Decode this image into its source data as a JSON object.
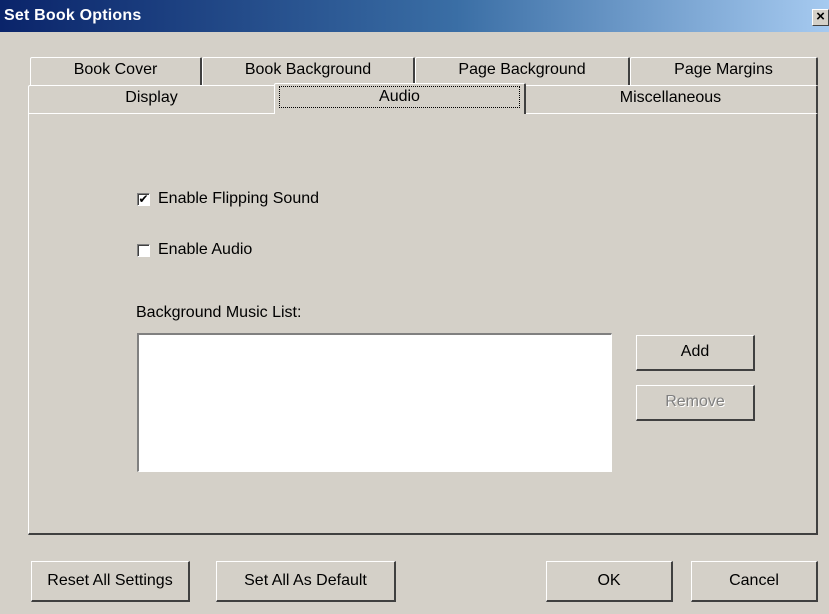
{
  "window": {
    "title": "Set Book Options",
    "close_glyph": "×"
  },
  "tabs_top": [
    {
      "label": "Book Cover"
    },
    {
      "label": "Book Background"
    },
    {
      "label": "Page Background"
    },
    {
      "label": "Page Margins"
    }
  ],
  "tabs_bottom": [
    {
      "label": "Display"
    },
    {
      "label": "Audio",
      "active": true
    },
    {
      "label": "Miscellaneous"
    }
  ],
  "audio": {
    "flipping_sound": {
      "label": "Enable Flipping Sound",
      "checked": true,
      "mark": "✔"
    },
    "enable_audio": {
      "label": "Enable Audio",
      "checked": false
    },
    "music_list_label": "Background Music List:",
    "music_list": [],
    "add_label": "Add",
    "remove_label": "Remove"
  },
  "footer": {
    "reset_label": "Reset All Settings",
    "default_label": "Set All As Default",
    "ok_label": "OK",
    "cancel_label": "Cancel"
  }
}
